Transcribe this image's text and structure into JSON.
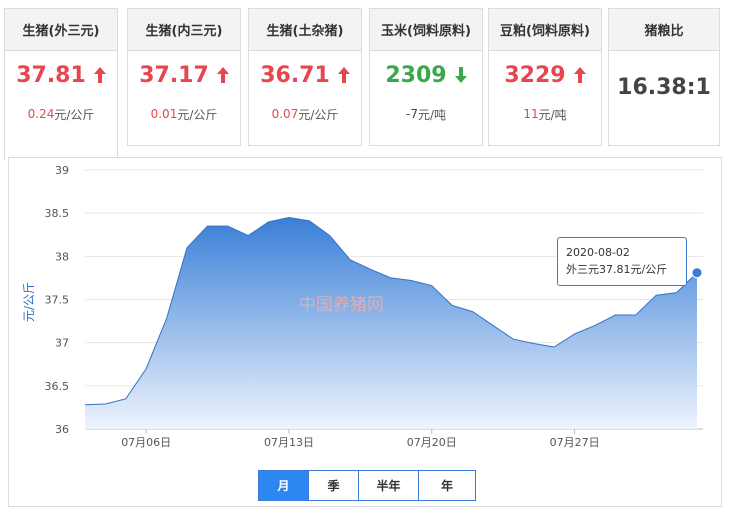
{
  "cards": [
    {
      "title": "生猪(外三元)",
      "price": "37.81",
      "arrow": "up",
      "change": "0.24",
      "unit": "元/公斤"
    },
    {
      "title": "生猪(内三元)",
      "price": "37.17",
      "arrow": "up",
      "change": "0.01",
      "unit": "元/公斤"
    },
    {
      "title": "生猪(土杂猪)",
      "price": "36.71",
      "arrow": "up",
      "change": "0.07",
      "unit": "元/公斤"
    },
    {
      "title": "玉米(饲料原料)",
      "price": "2309",
      "arrow": "down",
      "change": "-7",
      "unit": "元/吨"
    },
    {
      "title": "豆粕(饲料原料)",
      "price": "3229",
      "arrow": "up",
      "change": "11",
      "unit": "元/吨"
    },
    {
      "title": "猪粮比",
      "price": "16.38:1",
      "arrow": "none",
      "change": "",
      "unit": ""
    }
  ],
  "colors": {
    "up": "#e8464f",
    "down": "#3aa84a",
    "accent": "#2d87f0",
    "area_top": "#3a7fd8",
    "area_bottom": "#eef4fc"
  },
  "watermark": "中国养猪网",
  "tooltip": {
    "date": "2020-08-02",
    "text": "外三元37.81元/公斤"
  },
  "periods": [
    {
      "label": "月",
      "active": true
    },
    {
      "label": "季",
      "active": false
    },
    {
      "label": "半年",
      "active": false
    },
    {
      "label": "年",
      "active": false
    }
  ],
  "chart_data": {
    "type": "area",
    "title": "",
    "xlabel": "",
    "ylabel": "元/公斤",
    "ylim": [
      36,
      39
    ],
    "yticks": [
      36,
      36.5,
      37,
      37.5,
      38,
      38.5,
      39
    ],
    "ytick_labels": [
      "36",
      "36.5",
      "37",
      "37.5",
      "38",
      "38.5",
      "39"
    ],
    "xtick_labels": [
      {
        "x": "2020-07-06",
        "label": "07月06日"
      },
      {
        "x": "2020-07-13",
        "label": "07月13日"
      },
      {
        "x": "2020-07-20",
        "label": "07月20日"
      },
      {
        "x": "2020-07-27",
        "label": "07月27日"
      }
    ],
    "grid": true,
    "x": [
      "2020-07-03",
      "2020-07-04",
      "2020-07-05",
      "2020-07-06",
      "2020-07-07",
      "2020-07-08",
      "2020-07-09",
      "2020-07-10",
      "2020-07-11",
      "2020-07-12",
      "2020-07-13",
      "2020-07-14",
      "2020-07-15",
      "2020-07-16",
      "2020-07-17",
      "2020-07-18",
      "2020-07-19",
      "2020-07-20",
      "2020-07-21",
      "2020-07-22",
      "2020-07-23",
      "2020-07-24",
      "2020-07-25",
      "2020-07-26",
      "2020-07-27",
      "2020-07-28",
      "2020-07-29",
      "2020-07-30",
      "2020-07-31",
      "2020-08-01",
      "2020-08-02"
    ],
    "series": [
      {
        "values": [
          36.28,
          36.29,
          36.35,
          36.7,
          37.28,
          38.1,
          38.35,
          38.35,
          38.24,
          38.4,
          38.45,
          38.41,
          38.24,
          37.96,
          37.85,
          37.75,
          37.72,
          37.66,
          37.43,
          37.36,
          37.2,
          37.04,
          36.99,
          36.95,
          37.1,
          37.2,
          37.32,
          37.32,
          37.55,
          37.58,
          37.81
        ]
      }
    ],
    "highlight_index": 30
  }
}
